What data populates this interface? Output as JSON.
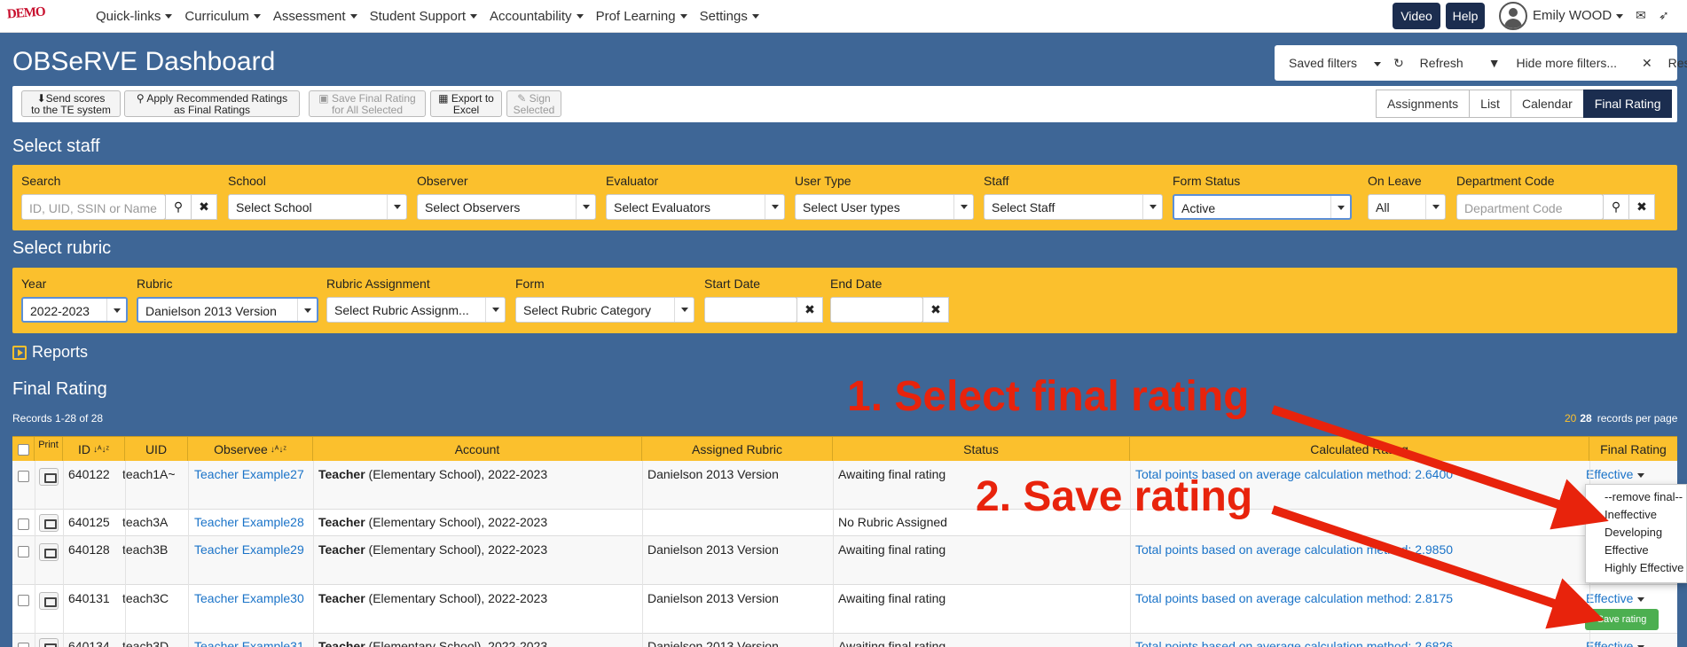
{
  "topnav": {
    "logo": "DEMO",
    "menu": [
      "Quick-links",
      "Curriculum",
      "Assessment",
      "Student Support",
      "Accountability",
      "Prof Learning",
      "Settings"
    ],
    "video": "Video",
    "help": "Help",
    "user": "Emily WOOD"
  },
  "page": {
    "title": "OBSeRVE Dashboard"
  },
  "filters": {
    "saved": "Saved filters",
    "refresh": "Refresh",
    "hide": "Hide more filters...",
    "reset": "Reset filters"
  },
  "toolbar": {
    "send": [
      "Send scores",
      "to the TE system"
    ],
    "apply": [
      "Apply Recommended Ratings",
      "as Final Ratings"
    ],
    "savefinal": [
      "Save Final Rating",
      "for All Selected"
    ],
    "export": [
      "Export to",
      "Excel"
    ],
    "sign": [
      "Sign",
      "Selected"
    ]
  },
  "views": [
    "Assignments",
    "List",
    "Calendar",
    "Final Rating"
  ],
  "staff": {
    "heading": "Select staff",
    "search_label": "Search",
    "search_placeholder": "ID, UID, SSIN or Name",
    "school_label": "School",
    "school": "Select School",
    "observer_label": "Observer",
    "observer": "Select Observers",
    "evaluator_label": "Evaluator",
    "evaluator": "Select Evaluators",
    "usertype_label": "User Type",
    "usertype": "Select User types",
    "staff_label": "Staff",
    "staff": "Select Staff",
    "formstatus_label": "Form Status",
    "formstatus": "Active",
    "onleave_label": "On Leave",
    "onleave": "All",
    "dept_label": "Department Code",
    "dept_placeholder": "Department Code"
  },
  "rubric": {
    "heading": "Select rubric",
    "year_label": "Year",
    "year": "2022-2023",
    "rubric_label": "Rubric",
    "rubric": "Danielson 2013 Version",
    "assignment_label": "Rubric Assignment",
    "assignment": "Select Rubric Assignm...",
    "form_label": "Form",
    "form": "Select Rubric Category",
    "start_label": "Start Date",
    "end_label": "End Date"
  },
  "reports": "Reports",
  "final": {
    "heading": "Final Rating",
    "records": "Records 1-28 of 28",
    "pp_20": "20",
    "pp_28": "28",
    "pp_label": "records per page"
  },
  "columns": {
    "print": "Print",
    "id": "ID",
    "uid": "UID",
    "observee": "Observee",
    "account": "Account",
    "rubric": "Assigned Rubric",
    "status": "Status",
    "calc": "Calculated Rating",
    "final": "Final Rating"
  },
  "rows": [
    {
      "id": "640122",
      "uid": "teach1A~",
      "name": "Teacher Example27",
      "acct_b": "Teacher",
      "acct": " (Elementary School), 2022-2023",
      "rubric": "Danielson 2013 Version",
      "status": "Awaiting final rating",
      "calc": "Total points based on average calculation method: 2.6400",
      "final": "Effective"
    },
    {
      "id": "640125",
      "uid": "teach3A",
      "name": "Teacher Example28",
      "acct_b": "Teacher",
      "acct": " (Elementary School), 2022-2023",
      "rubric": "",
      "status": "No Rubric Assigned",
      "calc": "",
      "final": ""
    },
    {
      "id": "640128",
      "uid": "teach3B",
      "name": "Teacher Example29",
      "acct_b": "Teacher",
      "acct": " (Elementary School), 2022-2023",
      "rubric": "Danielson 2013 Version",
      "status": "Awaiting final rating",
      "calc": "Total points based on average calculation method: 2.9850",
      "final": ""
    },
    {
      "id": "640131",
      "uid": "teach3C",
      "name": "Teacher Example30",
      "acct_b": "Teacher",
      "acct": " (Elementary School), 2022-2023",
      "rubric": "Danielson 2013 Version",
      "status": "Awaiting final rating",
      "calc": "Total points based on average calculation method: 2.8175",
      "final": "Effective"
    },
    {
      "id": "640134",
      "uid": "teach3D",
      "name": "Teacher Example31",
      "acct_b": "Teacher",
      "acct": " (Elementary School), 2022-2023",
      "rubric": "Danielson 2013 Version",
      "status": "Awaiting final rating",
      "calc": "Total points based on average calculation method: 2.6826",
      "final": "Effective"
    }
  ],
  "dropdown": [
    "--remove final--",
    "Ineffective",
    "Developing",
    "Effective",
    "Highly Effective"
  ],
  "save_rating": "Save rating",
  "annotations": {
    "a1": "1. Select final rating",
    "a2": "2. Save rating"
  },
  "colors": {
    "bg": "#3e6696",
    "yellow": "#fbc02d",
    "navy": "#1b2d4f",
    "link": "#1a73c8",
    "annot": "#e8230c",
    "save": "#4caf50"
  }
}
